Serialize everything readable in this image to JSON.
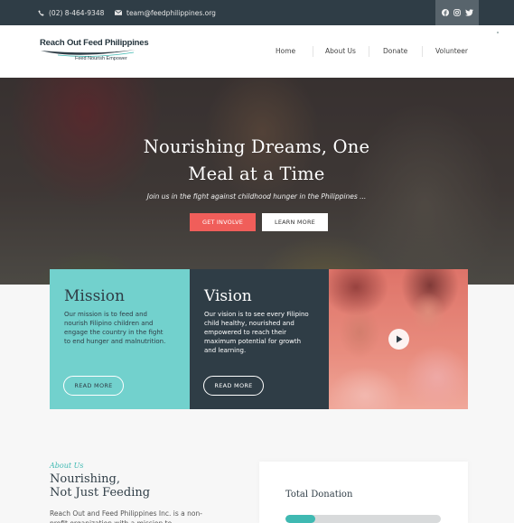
{
  "topbar": {
    "phone": "(02) 8-464-9348",
    "email": "team@feedphilippines.org",
    "socials": [
      "facebook-icon",
      "instagram-icon",
      "twitter-icon"
    ]
  },
  "header": {
    "logo_name": "Reach Out Feed Philippines",
    "logo_tagline": "Feed Nourish Empower",
    "nav": [
      "Home",
      "About Us",
      "Donate",
      "Volunteer"
    ]
  },
  "hero": {
    "title": "Nourishing Dreams, One Meal at a Time",
    "subtitle": "Join us in the fight against childhood hunger in the Philippines ...",
    "primary_button": "GET INVOLVE",
    "secondary_button": "LEARN MORE"
  },
  "mission": {
    "title": "Mission",
    "text": "Our mission is to feed and nourish Filipino children and engage the country in the fight to end hunger and malnutrition.",
    "button": "READ MORE"
  },
  "vision": {
    "title": "Vision",
    "text": "Our vision is to see every Filipino child healthy, nourished and empowered to reach their maximum potential for growth and learning.",
    "button": "READ MORE"
  },
  "about": {
    "label": "About Us",
    "title_line1": "Nourishing,",
    "title_line2": "Not Just Feeding",
    "text": "Reach Out and Feed Philippines Inc. is a non-profit organization with a mission to"
  },
  "donation": {
    "title": "Total Donation",
    "progress_fraction": 0.19
  },
  "colors": {
    "dark": "#2f3d46",
    "teal": "#72d1cd",
    "accent_teal": "#3fb9b2",
    "coral": "#f05e5a"
  }
}
